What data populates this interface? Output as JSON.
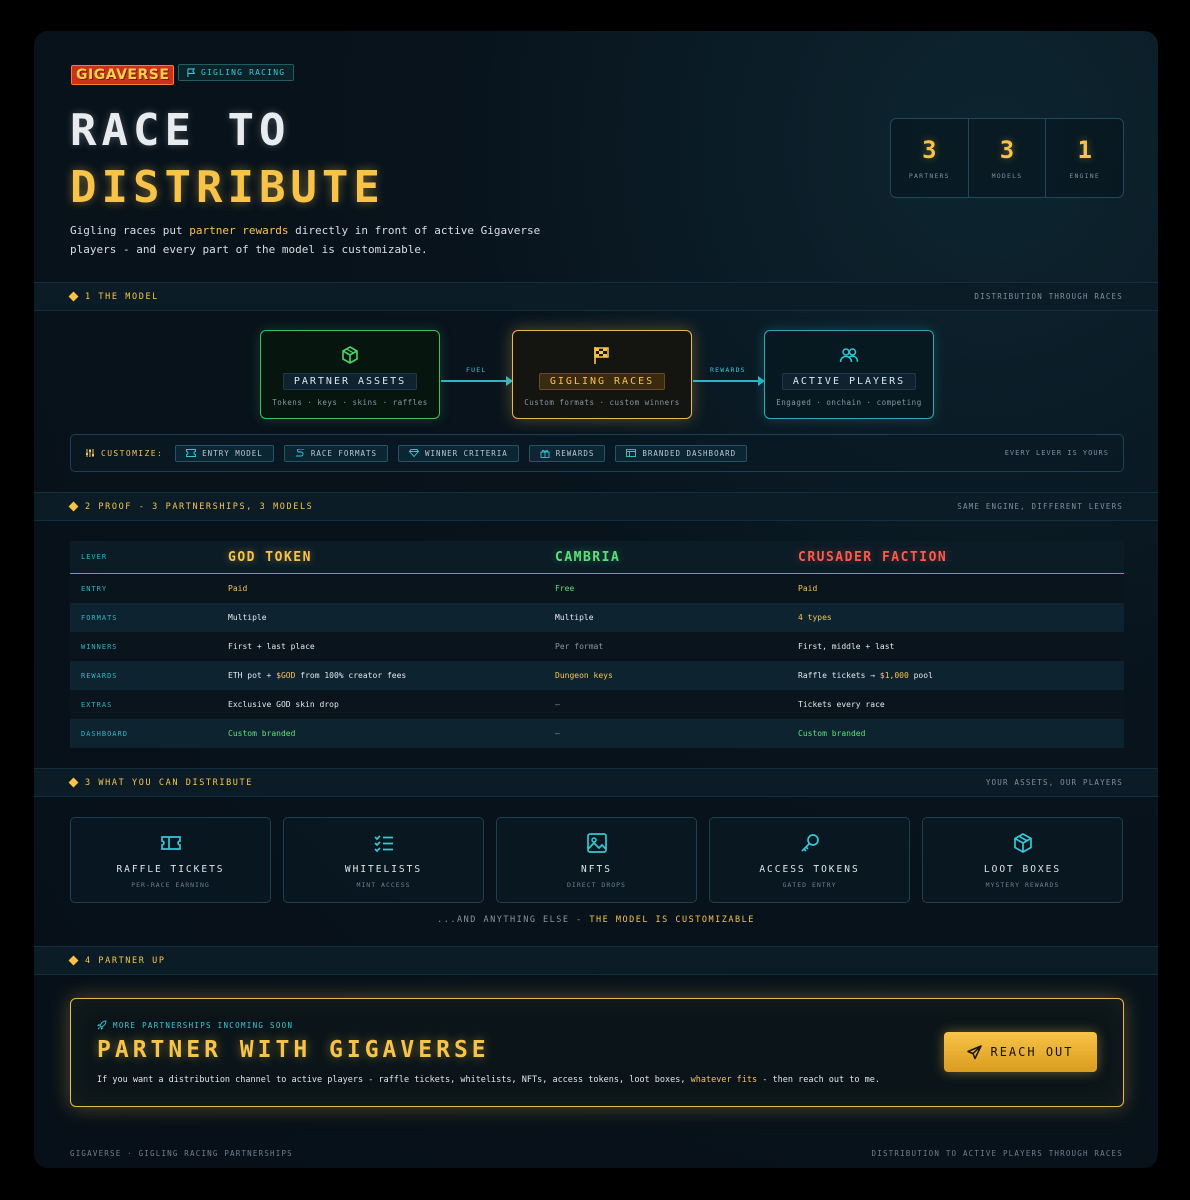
{
  "header": {
    "logo": "GIGAVERSE",
    "tag": "GIGLING RACING",
    "title_line1": "RACE TO",
    "title_line2": "DISTRIBUTE",
    "intro_a": "Gigling races put ",
    "intro_hl": "partner rewards",
    "intro_b": " directly in front of active Gigaverse players - and every part of the model is customizable.",
    "stats": [
      {
        "value": "3",
        "label": "PARTNERS"
      },
      {
        "value": "3",
        "label": "MODELS"
      },
      {
        "value": "1",
        "label": "ENGINE"
      }
    ]
  },
  "sections": {
    "s1": {
      "title": "1 THE MODEL",
      "right": "DISTRIBUTION THROUGH RACES"
    },
    "s2": {
      "title": "2 PROOF - 3 PARTNERSHIPS, 3 MODELS",
      "right": "SAME ENGINE, DIFFERENT LEVERS"
    },
    "s3": {
      "title": "3 WHAT YOU CAN DISTRIBUTE",
      "right": "YOUR ASSETS, OUR PLAYERS"
    },
    "s4": {
      "title": "4 PARTNER UP",
      "right": ""
    }
  },
  "model": {
    "boxes": [
      {
        "label": "PARTNER ASSETS",
        "sub": "Tokens · keys · skins · raffles",
        "icon": "cube-icon"
      },
      {
        "label": "GIGLING RACES",
        "sub": "Custom formats · custom winners",
        "icon": "checkered-flag-icon"
      },
      {
        "label": "ACTIVE PLAYERS",
        "sub": "Engaged · onchain · competing",
        "icon": "users-icon"
      }
    ],
    "arrow1": "FUEL",
    "arrow2": "REWARDS"
  },
  "customize": {
    "label": "CUSTOMIZE:",
    "chips": [
      "ENTRY MODEL",
      "RACE FORMATS",
      "WINNER CRITERIA",
      "REWARDS",
      "BRANDED DASHBOARD"
    ],
    "right": "EVERY LEVER IS YOURS"
  },
  "table": {
    "headers": [
      "LEVER",
      "GOD TOKEN",
      "CAMBRIA",
      "CRUSADER FACTION"
    ],
    "rows": [
      {
        "lever": "ENTRY",
        "a": "Paid",
        "b": "Free",
        "c": "Paid"
      },
      {
        "lever": "FORMATS",
        "a": "Multiple",
        "b": "Multiple",
        "c": "4 types"
      },
      {
        "lever": "WINNERS",
        "a": "First + last place",
        "b": "Per format",
        "c": "First, middle + last"
      },
      {
        "lever": "REWARDS",
        "a1": "ETH pot + ",
        "a2": "$GOD",
        "a3": " from 100% creator fees",
        "b": "Dungeon keys",
        "c1": "Raffle tickets → ",
        "c2": "$1,000",
        "c3": " pool"
      },
      {
        "lever": "EXTRAS",
        "a": "Exclusive GOD skin drop",
        "b": "–",
        "c": "Tickets every race"
      },
      {
        "lever": "DASHBOARD",
        "a": "Custom branded",
        "b": "–",
        "c": "Custom branded"
      }
    ]
  },
  "distribute": {
    "cards": [
      {
        "title": "RAFFLE TICKETS",
        "sub": "PER-RACE EARNING",
        "icon": "ticket-icon"
      },
      {
        "title": "WHITELISTS",
        "sub": "MINT ACCESS",
        "icon": "checklist-icon"
      },
      {
        "title": "NFTS",
        "sub": "DIRECT DROPS",
        "icon": "image-icon"
      },
      {
        "title": "ACCESS TOKENS",
        "sub": "GATED ENTRY",
        "icon": "key-icon"
      },
      {
        "title": "LOOT BOXES",
        "sub": "MYSTERY REWARDS",
        "icon": "box-icon"
      }
    ],
    "more_a": "...AND ANYTHING ELSE - ",
    "more_b": "THE MODEL IS CUSTOMIZABLE"
  },
  "cta": {
    "kicker": "MORE PARTNERSHIPS INCOMING SOON",
    "title": "PARTNER WITH GIGAVERSE",
    "text_a": "If you want a distribution channel to active players - raffle tickets, whitelists, NFTs, access tokens, loot boxes, ",
    "text_hl": "whatever fits",
    "text_b": " - then reach out to me.",
    "button": "REACH OUT"
  },
  "footer": {
    "left": "GIGAVERSE · GIGLING RACING PARTNERSHIPS",
    "right": "DISTRIBUTION TO ACTIVE PLAYERS THROUGH RACES"
  },
  "colors": {
    "accent": "#f7c449",
    "cyan": "#2ab6c4",
    "green": "#5de07a",
    "red": "#ff5a4a"
  }
}
